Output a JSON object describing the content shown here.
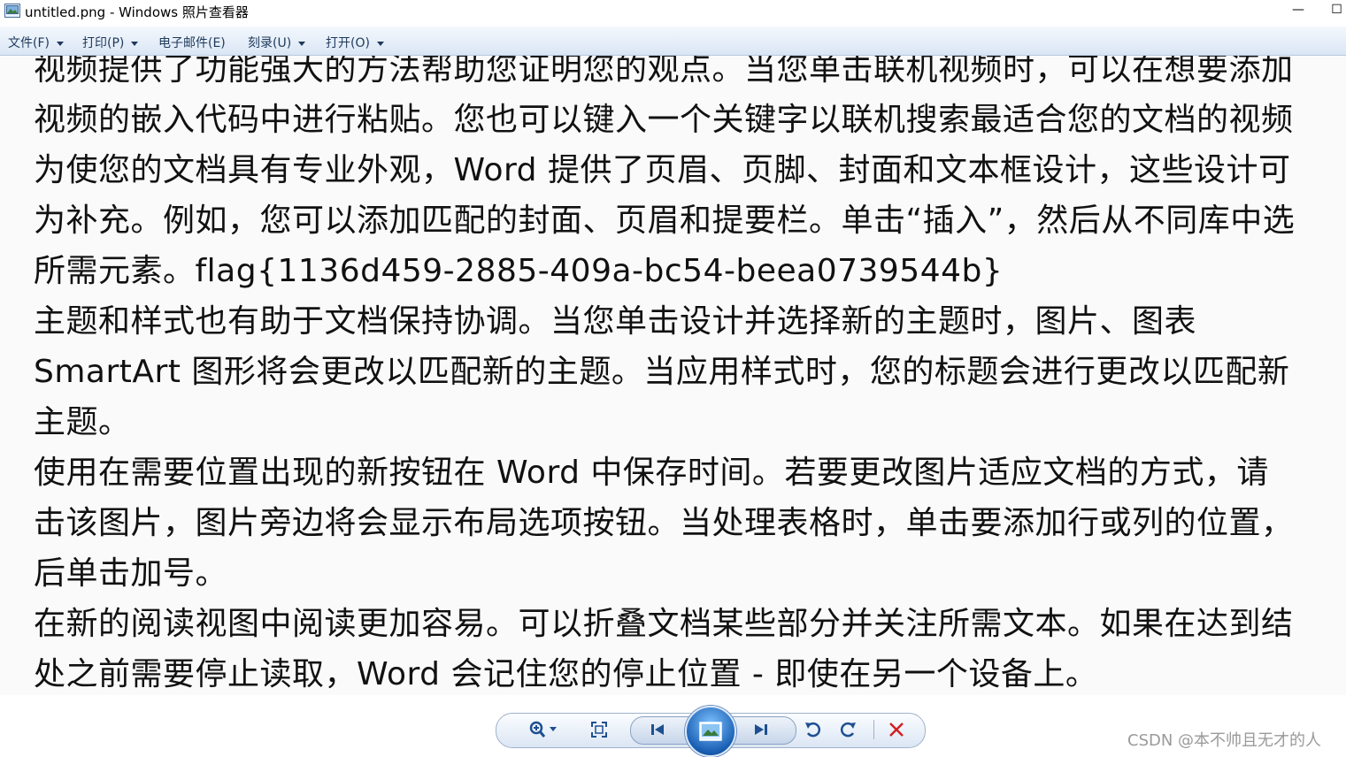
{
  "window": {
    "title": "untitled.png - Windows 照片查看器"
  },
  "menu": {
    "items": [
      {
        "label": "文件(F)"
      },
      {
        "label": "打印(P)"
      },
      {
        "label": "电子邮件(E)"
      },
      {
        "label": "刻录(U)"
      },
      {
        "label": "打开(O)"
      }
    ]
  },
  "document": {
    "lines": [
      "视频提供了功能强大的方法帮助您证明您的观点。当您单击联机视频时，可以在想要添加",
      "视频的嵌入代码中进行粘贴。您也可以键入一个关键字以联机搜索最适合您的文档的视频",
      "为使您的文档具有专业外观，Word 提供了页眉、页脚、封面和文本框设计，这些设计可",
      "为补充。例如，您可以添加匹配的封面、页眉和提要栏。单击“插入”，然后从不同库中选",
      "所需元素。flag{1136d459-2885-409a-bc54-beea0739544b}",
      "主题和样式也有助于文档保持协调。当您单击设计并选择新的主题时，图片、图表",
      "SmartArt 图形将会更改以匹配新的主题。当应用样式时，您的标题会进行更改以匹配新",
      "主题。",
      "使用在需要位置出现的新按钮在 Word 中保存时间。若要更改图片适应文档的方式，请",
      "击该图片，图片旁边将会显示布局选项按钮。当处理表格时，单击要添加行或列的位置，",
      "后单击加号。",
      "在新的阅读视图中阅读更加容易。可以折叠文档某些部分并关注所需文本。如果在达到结",
      "处之前需要停止读取，Word 会记住您的停止位置 - 即使在另一个设备上。"
    ]
  },
  "toolbar": {
    "icons": [
      "zoom-icon",
      "fit-window-icon",
      "previous-icon",
      "slideshow-icon",
      "next-icon",
      "rotate-left-icon",
      "rotate-right-icon",
      "delete-icon"
    ]
  },
  "watermark": "CSDN @本不帅且无才的人"
}
